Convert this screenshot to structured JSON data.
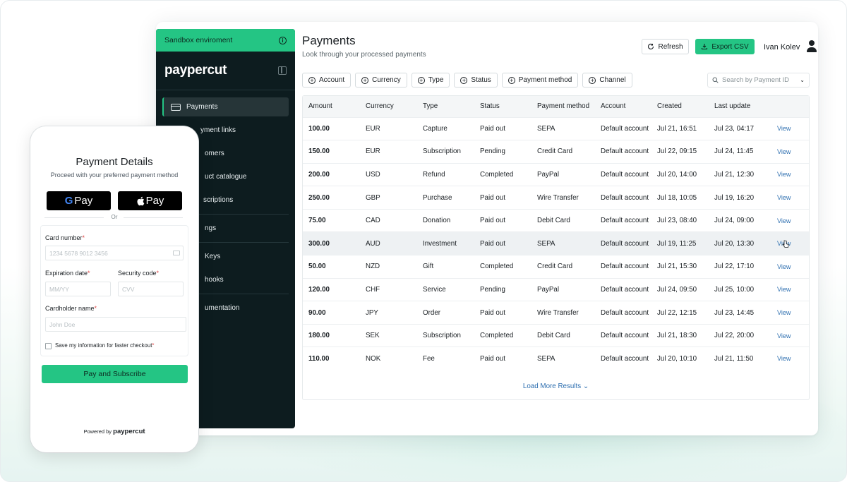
{
  "sidebar": {
    "sandbox_label": "Sandbox enviroment",
    "logo": "paypercut",
    "items": [
      {
        "label": "Payments"
      },
      {
        "label": "yment links"
      },
      {
        "label": "omers"
      },
      {
        "label": "uct catalogue"
      },
      {
        "label": "scriptions"
      },
      {
        "label": "ngs"
      },
      {
        "label": "Keys"
      },
      {
        "label": "hooks"
      },
      {
        "label": "umentation"
      }
    ]
  },
  "header": {
    "title": "Payments",
    "subtitle": "Look through your processed payments",
    "refresh_label": "Refresh",
    "export_label": "Export CSV",
    "user_name": "Ivan Kolev"
  },
  "filters": [
    "Account",
    "Currency",
    "Type",
    "Status",
    "Payment method",
    "Channel"
  ],
  "search": {
    "placeholder": "Search by Payment ID"
  },
  "table": {
    "columns": [
      "Amount",
      "Currency",
      "Type",
      "Status",
      "Payment method",
      "Account",
      "Created",
      "Last update",
      ""
    ],
    "rows": [
      [
        "100.00",
        "EUR",
        "Capture",
        "Paid out",
        "SEPA",
        "Default account",
        "Jul 21, 16:51",
        "Jul 23, 04:17",
        "View"
      ],
      [
        "150.00",
        "EUR",
        "Subscription",
        "Pending",
        "Credit Card",
        "Default account",
        "Jul 22, 09:15",
        "Jul 24, 11:45",
        "View"
      ],
      [
        "200.00",
        "USD",
        "Refund",
        "Completed",
        "PayPal",
        "Default account",
        "Jul 20, 14:00",
        "Jul 21, 12:30",
        "View"
      ],
      [
        "250.00",
        "GBP",
        "Purchase",
        "Paid out",
        "Wire Transfer",
        "Default account",
        "Jul 18, 10:05",
        "Jul 19, 16:20",
        "View"
      ],
      [
        "75.00",
        "CAD",
        "Donation",
        "Paid out",
        "Debit Card",
        "Default account",
        "Jul 23, 08:40",
        "Jul 24, 09:00",
        "View"
      ],
      [
        "300.00",
        "AUD",
        "Investment",
        "Paid out",
        "SEPA",
        "Default account",
        "Jul 19, 11:25",
        "Jul 20, 13:30",
        "View"
      ],
      [
        "50.00",
        "NZD",
        "Gift",
        "Completed",
        "Credit Card",
        "Default account",
        "Jul 21, 15:30",
        "Jul 22, 17:10",
        "View"
      ],
      [
        "120.00",
        "CHF",
        "Service",
        "Pending",
        "PayPal",
        "Default account",
        "Jul 24, 09:50",
        "Jul 25, 10:00",
        "View"
      ],
      [
        "90.00",
        "JPY",
        "Order",
        "Paid out",
        "Wire Transfer",
        "Default account",
        "Jul 22, 12:15",
        "Jul 23, 14:45",
        "View"
      ],
      [
        "180.00",
        "SEK",
        "Subscription",
        "Completed",
        "Debit Card",
        "Default account",
        "Jul 21, 18:30",
        "Jul 22, 20:00",
        "View"
      ],
      [
        "110.00",
        "NOK",
        "Fee",
        "Paid out",
        "SEPA",
        "Default account",
        "Jul 20, 10:10",
        "Jul 21, 11:50",
        "View"
      ]
    ],
    "load_more": "Load More Results"
  },
  "phone": {
    "title": "Payment Details",
    "subtitle": "Proceed with your preferred payment method",
    "gpay_label": "Pay",
    "applepay_label": "Pay",
    "or_label": "Or",
    "card_number_label": "Card number",
    "card_number_placeholder": "1234 5678 9012 3456",
    "expiry_label": "Expiration date",
    "expiry_placeholder": "MM/YY",
    "security_label": "Security code",
    "security_placeholder": "CVV",
    "cardholder_label": "Cardholder name",
    "cardholder_placeholder": "John Doe",
    "save_info_label": "Save my information for faster checkout",
    "pay_button": "Pay and Subscribe",
    "powered_by": "Powered by",
    "powered_brand": "paypercut"
  },
  "colors": {
    "accent": "#24c584",
    "sidebar": "#0d1c1f",
    "link": "#2e6fb0"
  }
}
